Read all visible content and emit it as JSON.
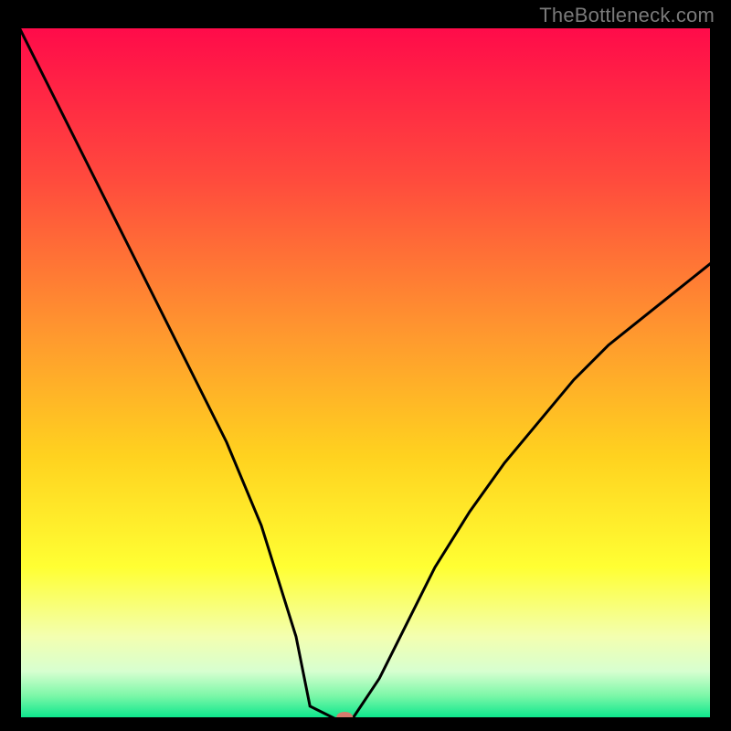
{
  "watermark": "TheBottleneck.com",
  "chart_data": {
    "type": "line",
    "title": "",
    "xlabel": "",
    "ylabel": "",
    "xlim": [
      0,
      100
    ],
    "ylim": [
      0,
      100
    ],
    "series": [
      {
        "name": "bottleneck-curve",
        "x": [
          0,
          5,
          10,
          15,
          20,
          25,
          30,
          35,
          40,
          42,
          46,
          48,
          52,
          55,
          60,
          65,
          70,
          75,
          80,
          85,
          90,
          95,
          100
        ],
        "y": [
          100,
          90,
          80,
          70,
          60,
          50,
          40,
          28,
          12,
          2,
          0,
          0,
          6,
          12,
          22,
          30,
          37,
          43,
          49,
          54,
          58,
          62,
          66
        ]
      }
    ],
    "marker": {
      "x": 47,
      "y": 0,
      "color": "#d77b6e"
    },
    "gradient_stops": [
      {
        "offset": 0.0,
        "color": "#ff0a4a"
      },
      {
        "offset": 0.22,
        "color": "#ff4a3d"
      },
      {
        "offset": 0.45,
        "color": "#ff9a2e"
      },
      {
        "offset": 0.62,
        "color": "#ffd21f"
      },
      {
        "offset": 0.78,
        "color": "#ffff33"
      },
      {
        "offset": 0.88,
        "color": "#f3ffb0"
      },
      {
        "offset": 0.93,
        "color": "#d7ffd0"
      },
      {
        "offset": 0.965,
        "color": "#7cf7a8"
      },
      {
        "offset": 1.0,
        "color": "#00e58a"
      }
    ],
    "curve_color": "#000000",
    "curve_width": 3
  }
}
